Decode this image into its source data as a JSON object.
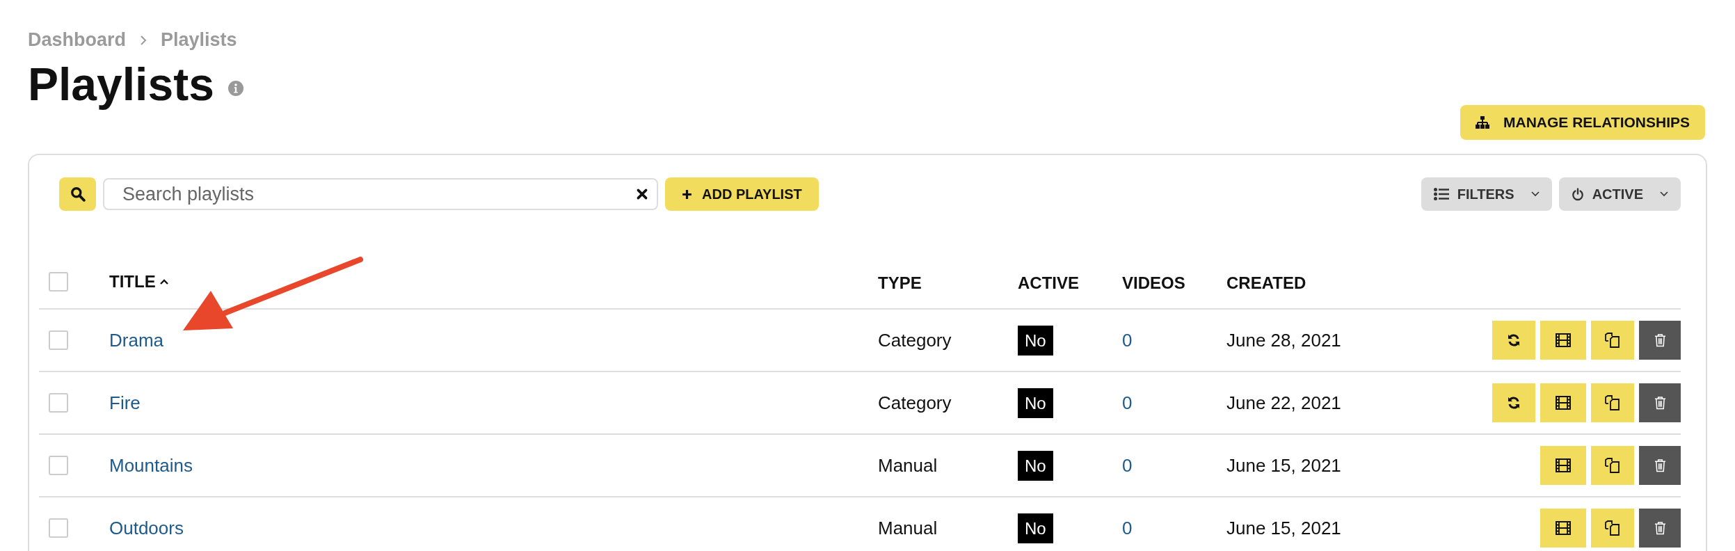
{
  "breadcrumb": [
    "Dashboard",
    "Playlists"
  ],
  "title": "Playlists",
  "manage_button": "MANAGE RELATIONSHIPS",
  "search": {
    "placeholder": "Search playlists"
  },
  "add_button": "ADD PLAYLIST",
  "filters_button": "FILTERS",
  "active_button": "ACTIVE",
  "table": {
    "select_all": {
      "checked": false
    },
    "columns": [
      {
        "label": "TITLE",
        "sorted": true
      },
      {
        "label": "TYPE",
        "sorted": false
      },
      {
        "label": "ACTIVE",
        "sorted": false
      },
      {
        "label": "VIDEOS",
        "sorted": false
      },
      {
        "label": "CREATED",
        "sorted": false
      }
    ],
    "rows": [
      {
        "checked": false,
        "title": "Drama",
        "type": "Category",
        "active": "No",
        "videos": "0",
        "created": "June 28, 2021",
        "sync": true
      },
      {
        "checked": false,
        "title": "Fire",
        "type": "Category",
        "active": "No",
        "videos": "0",
        "created": "June 22, 2021",
        "sync": true
      },
      {
        "checked": false,
        "title": "Mountains",
        "type": "Manual",
        "active": "No",
        "videos": "0",
        "created": "June 15, 2021",
        "sync": false
      },
      {
        "checked": false,
        "title": "Outdoors",
        "type": "Manual",
        "active": "No",
        "videos": "0",
        "created": "June 15, 2021",
        "sync": false
      }
    ]
  }
}
